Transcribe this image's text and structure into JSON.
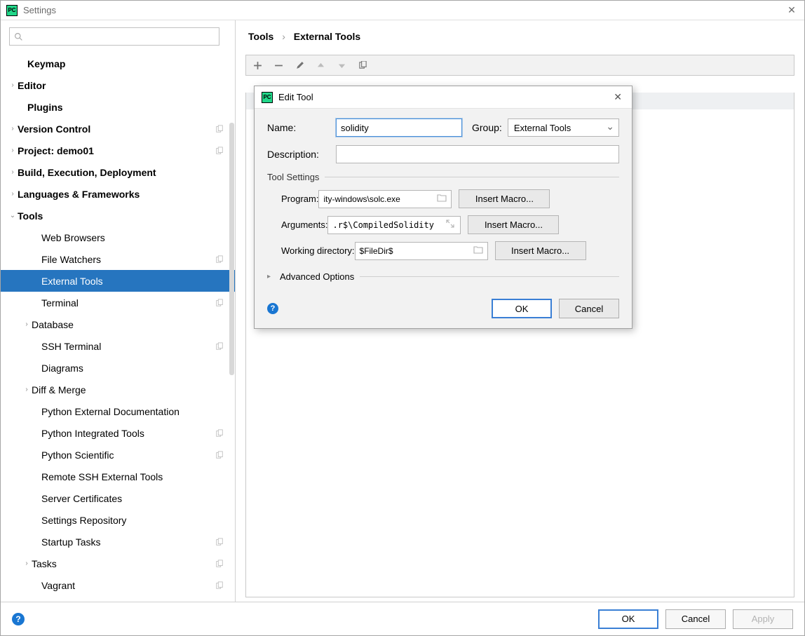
{
  "window": {
    "title": "Settings"
  },
  "sidebar": {
    "search_placeholder": "",
    "items": [
      {
        "label": "Keymap",
        "bold": true,
        "indent": 0,
        "expander": "",
        "copy": false
      },
      {
        "label": "Editor",
        "bold": true,
        "indent": 0,
        "expander": "›",
        "copy": false
      },
      {
        "label": "Plugins",
        "bold": true,
        "indent": 0,
        "expander": "",
        "copy": false
      },
      {
        "label": "Version Control",
        "bold": true,
        "indent": 0,
        "expander": "›",
        "copy": true
      },
      {
        "label": "Project: demo01",
        "bold": true,
        "indent": 0,
        "expander": "›",
        "copy": true
      },
      {
        "label": "Build, Execution, Deployment",
        "bold": true,
        "indent": 0,
        "expander": "›",
        "copy": false
      },
      {
        "label": "Languages & Frameworks",
        "bold": true,
        "indent": 0,
        "expander": "›",
        "copy": false
      },
      {
        "label": "Tools",
        "bold": true,
        "indent": 0,
        "expander": "⌄",
        "copy": false
      },
      {
        "label": "Web Browsers",
        "bold": false,
        "indent": 1,
        "expander": "",
        "copy": false
      },
      {
        "label": "File Watchers",
        "bold": false,
        "indent": 1,
        "expander": "",
        "copy": true
      },
      {
        "label": "External Tools",
        "bold": false,
        "indent": 1,
        "expander": "",
        "copy": false,
        "selected": true
      },
      {
        "label": "Terminal",
        "bold": false,
        "indent": 1,
        "expander": "",
        "copy": true
      },
      {
        "label": "Database",
        "bold": false,
        "indent": 1,
        "expander": "›",
        "copy": false
      },
      {
        "label": "SSH Terminal",
        "bold": false,
        "indent": 1,
        "expander": "",
        "copy": true
      },
      {
        "label": "Diagrams",
        "bold": false,
        "indent": 1,
        "expander": "",
        "copy": false
      },
      {
        "label": "Diff & Merge",
        "bold": false,
        "indent": 1,
        "expander": "›",
        "copy": false
      },
      {
        "label": "Python External Documentation",
        "bold": false,
        "indent": 1,
        "expander": "",
        "copy": false
      },
      {
        "label": "Python Integrated Tools",
        "bold": false,
        "indent": 1,
        "expander": "",
        "copy": true
      },
      {
        "label": "Python Scientific",
        "bold": false,
        "indent": 1,
        "expander": "",
        "copy": true
      },
      {
        "label": "Remote SSH External Tools",
        "bold": false,
        "indent": 1,
        "expander": "",
        "copy": false
      },
      {
        "label": "Server Certificates",
        "bold": false,
        "indent": 1,
        "expander": "",
        "copy": false
      },
      {
        "label": "Settings Repository",
        "bold": false,
        "indent": 1,
        "expander": "",
        "copy": false
      },
      {
        "label": "Startup Tasks",
        "bold": false,
        "indent": 1,
        "expander": "",
        "copy": true
      },
      {
        "label": "Tasks",
        "bold": false,
        "indent": 1,
        "expander": "›",
        "copy": true
      },
      {
        "label": "Vagrant",
        "bold": false,
        "indent": 1,
        "expander": "",
        "copy": true
      }
    ]
  },
  "breadcrumb": {
    "root": "Tools",
    "current": "External Tools"
  },
  "dialog": {
    "title": "Edit Tool",
    "labels": {
      "name": "Name:",
      "group": "Group:",
      "description": "Description:",
      "tool_settings": "Tool Settings",
      "program": "Program:",
      "arguments": "Arguments:",
      "working_dir": "Working directory:",
      "advanced": "Advanced Options",
      "insert_macro": "Insert Macro...",
      "ok": "OK",
      "cancel": "Cancel"
    },
    "values": {
      "name": "solidity",
      "group": "External Tools",
      "description": "",
      "program": "ity-windows\\solc.exe",
      "arguments": ".r$\\CompiledSolidity",
      "working_dir": "$FileDir$"
    }
  },
  "footer": {
    "ok": "OK",
    "cancel": "Cancel",
    "apply": "Apply"
  }
}
